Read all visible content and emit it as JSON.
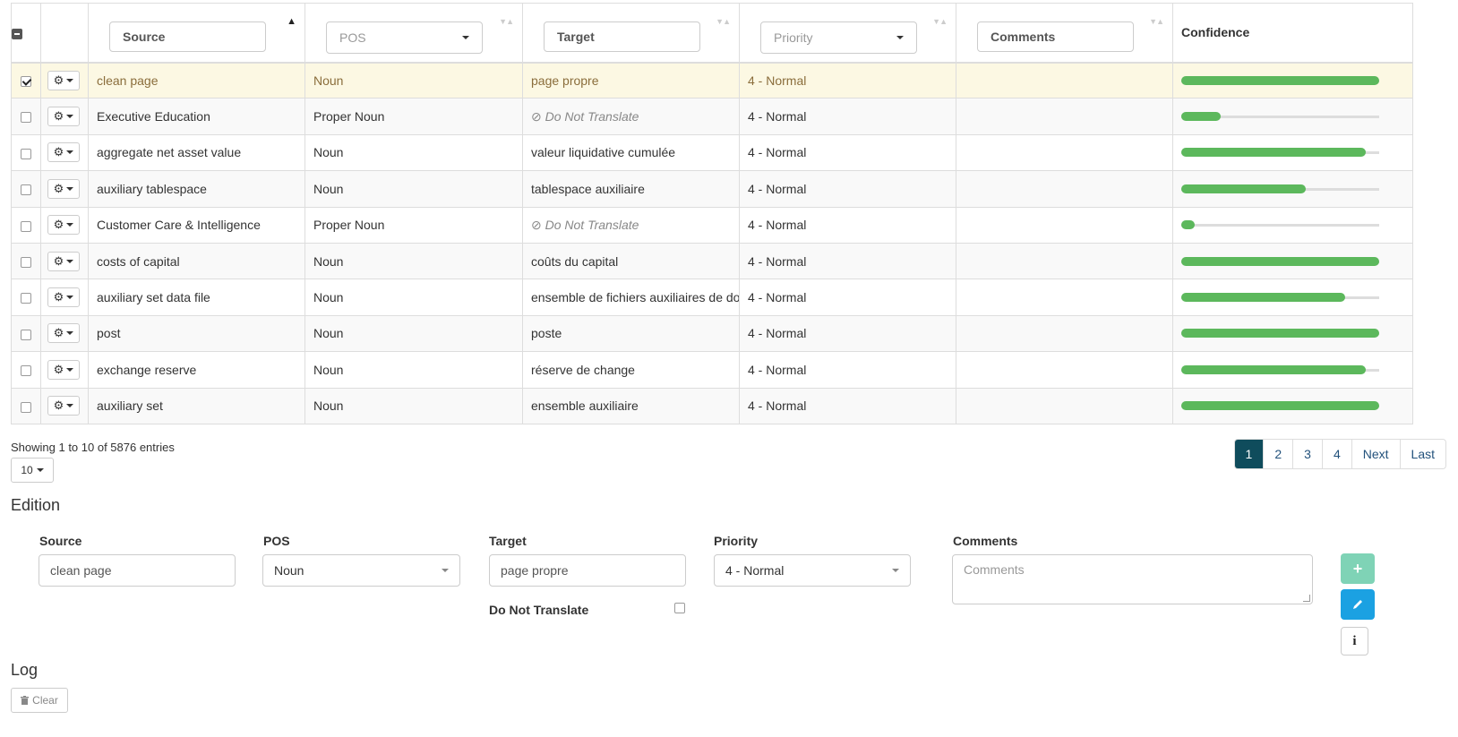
{
  "columns": {
    "source": "Source",
    "pos": "POS",
    "target": "Target",
    "priority": "Priority",
    "comments": "Comments",
    "confidence": "Confidence"
  },
  "rows": [
    {
      "source": "clean page",
      "pos": "Noun",
      "target": "page propre",
      "priority": "4 - Normal",
      "comments": "",
      "confidence": 1.0,
      "dnt": false,
      "checked": true
    },
    {
      "source": "Executive Education",
      "pos": "Proper Noun",
      "target": "Do Not Translate",
      "priority": "4 - Normal",
      "comments": "",
      "confidence": 0.2,
      "dnt": true,
      "checked": false
    },
    {
      "source": "aggregate net asset value",
      "pos": "Noun",
      "target": "valeur liquidative cumulée",
      "priority": "4 - Normal",
      "comments": "",
      "confidence": 0.93,
      "dnt": false,
      "checked": false
    },
    {
      "source": "auxiliary tablespace",
      "pos": "Noun",
      "target": "tablespace auxiliaire",
      "priority": "4 - Normal",
      "comments": "",
      "confidence": 0.63,
      "dnt": false,
      "checked": false
    },
    {
      "source": "Customer Care & Intelligence",
      "pos": "Proper Noun",
      "target": "Do Not Translate",
      "priority": "4 - Normal",
      "comments": "",
      "confidence": 0.07,
      "dnt": true,
      "checked": false
    },
    {
      "source": "costs of capital",
      "pos": "Noun",
      "target": "coûts du capital",
      "priority": "4 - Normal",
      "comments": "",
      "confidence": 1.0,
      "dnt": false,
      "checked": false
    },
    {
      "source": "auxiliary set data file",
      "pos": "Noun",
      "target": "ensemble de fichiers auxiliaires de don",
      "priority": "4 - Normal",
      "comments": "",
      "confidence": 0.83,
      "dnt": false,
      "checked": false
    },
    {
      "source": "post",
      "pos": "Noun",
      "target": "poste",
      "priority": "4 - Normal",
      "comments": "",
      "confidence": 1.0,
      "dnt": false,
      "checked": false
    },
    {
      "source": "exchange reserve",
      "pos": "Noun",
      "target": "réserve de change",
      "priority": "4 - Normal",
      "comments": "",
      "confidence": 0.93,
      "dnt": false,
      "checked": false
    },
    {
      "source": "auxiliary set",
      "pos": "Noun",
      "target": "ensemble auxiliaire",
      "priority": "4 - Normal",
      "comments": "",
      "confidence": 1.0,
      "dnt": false,
      "checked": false
    }
  ],
  "filters": {
    "source_placeholder": "Source",
    "pos_placeholder": "POS",
    "target_placeholder": "Target",
    "priority_placeholder": "Priority",
    "comments_placeholder": "Comments"
  },
  "pagination": {
    "info": "Showing 1 to 10 of 5876 entries",
    "page_length": "10",
    "pages": [
      "1",
      "2",
      "3",
      "4"
    ],
    "active_page": "1",
    "next": "Next",
    "last": "Last"
  },
  "edition": {
    "title": "Edition",
    "source_label": "Source",
    "source_value": "clean page",
    "pos_label": "POS",
    "pos_value": "Noun",
    "target_label": "Target",
    "target_value": "page propre",
    "priority_label": "Priority",
    "priority_value": "4 - Normal",
    "comments_label": "Comments",
    "comments_placeholder": "Comments",
    "dnt_label": "Do Not Translate",
    "add_icon": "+",
    "info_icon": "i"
  },
  "log": {
    "title": "Log",
    "clear_label": "Clear"
  },
  "colors": {
    "selected_row_bg": "#fcf8e3",
    "selected_row_text": "#8a6d3b",
    "bar_green": "#5cb85c",
    "page_active": "#0f4c5c",
    "add_button": "#7fd3b6",
    "edit_button": "#1ba1e2"
  },
  "icons": {
    "row_action": "gear-icon",
    "dnt": "ban-icon",
    "clear": "trash-icon",
    "add": "plus-icon",
    "edit": "pencil-icon",
    "info": "info-icon"
  }
}
